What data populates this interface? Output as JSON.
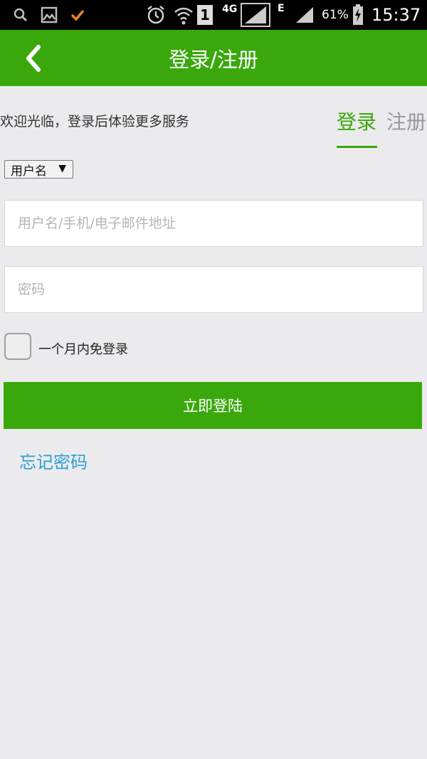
{
  "status_bar": {
    "network_type": "4G",
    "sim_slot": "1",
    "edge_label": "E",
    "battery_percent": "61%",
    "time": "15:37",
    "icons": [
      "search-icon",
      "gallery-icon",
      "check-icon",
      "alarm-icon",
      "wifi-icon",
      "signal-icon",
      "battery-charging-icon"
    ]
  },
  "app_bar": {
    "title": "登录/注册",
    "back_icon": "chevron-left-icon",
    "color": "#3aa80c"
  },
  "welcome_text": "欢迎光临，登录后体验更多服务",
  "tabs": [
    {
      "label": "登录",
      "active": true
    },
    {
      "label": "注册",
      "active": false
    }
  ],
  "account_type_select": {
    "selected": "用户名",
    "arrow": "▼"
  },
  "username_field": {
    "placeholder": "用户名/手机/电子邮件地址",
    "value": ""
  },
  "password_field": {
    "placeholder": "密码",
    "value": ""
  },
  "remember": {
    "label": "一个月内免登录",
    "checked": false
  },
  "login_button": {
    "label": "立即登陆"
  },
  "forgot_password": {
    "label": "忘记密码",
    "color": "#2c9fd2"
  }
}
